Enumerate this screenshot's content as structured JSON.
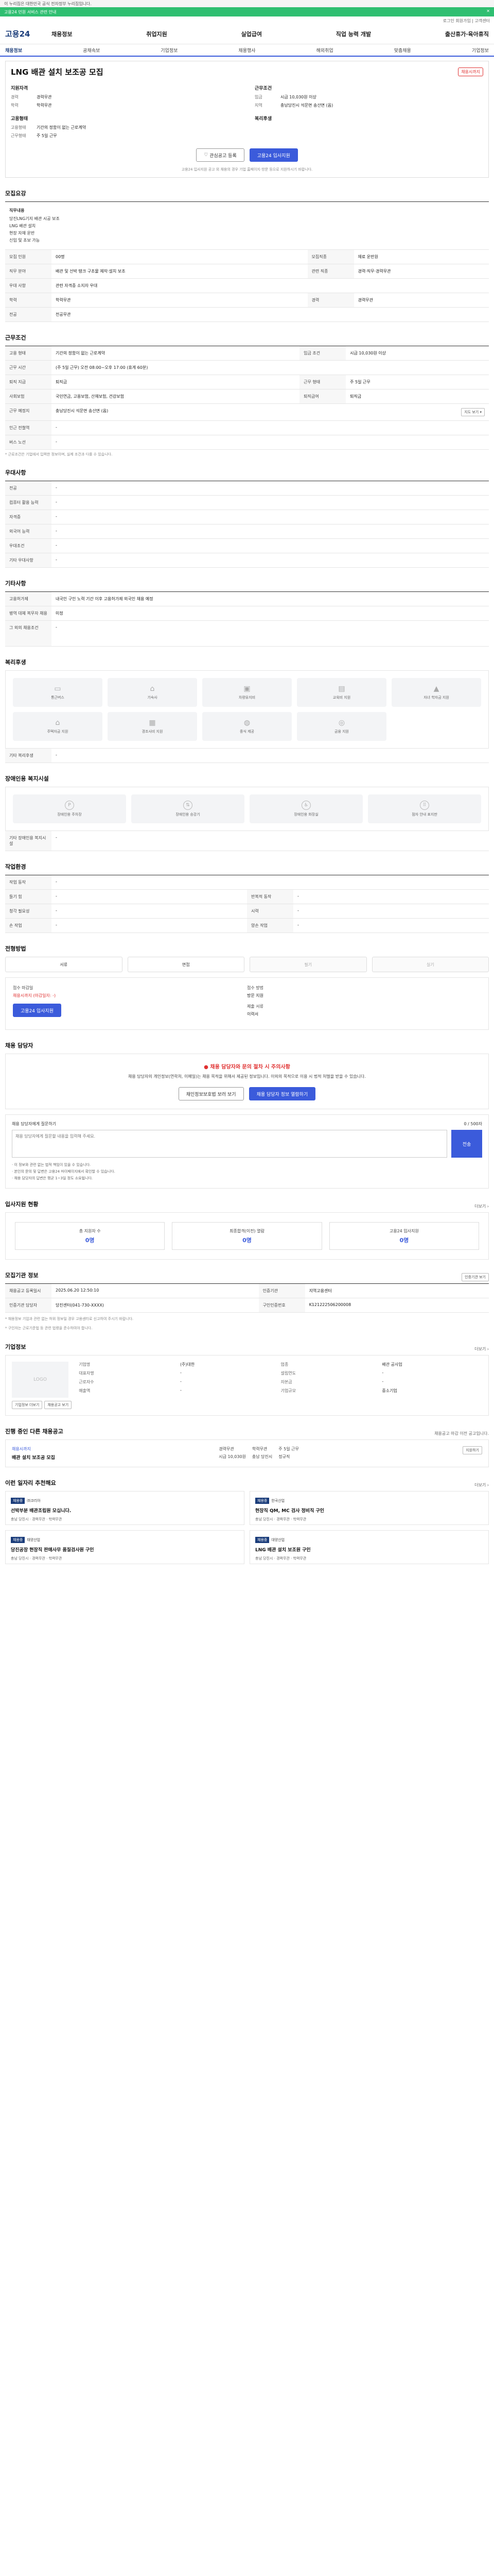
{
  "gov_bar": "이 누리집은 대한민국 공식 전자정부 누리집입니다.",
  "banner": {
    "text": "고용24 민원 서비스 관련 안내",
    "close": "✕"
  },
  "util": "로그인 회원가입 | 고객센터",
  "brand": "고용24",
  "gnb": [
    "채용정보",
    "취업지원",
    "실업급여",
    "직업 능력 개발",
    "출산휴가·육아휴직"
  ],
  "tabs": [
    "채용정보",
    "공채속보",
    "기업정보",
    "채용행사",
    "해외취업",
    "맞춤채용",
    "기업정보"
  ],
  "job": {
    "title": "LNG 배관 설치 보조공 모집",
    "badge": "채용시까지",
    "left_head": "지원자격",
    "left": [
      [
        "경력",
        "경력무관"
      ],
      [
        "학력",
        "학력무관"
      ]
    ],
    "right_head": "근무조건",
    "right": [
      [
        "임금",
        "시급 10,030원 이상"
      ],
      [
        "지역",
        "충남당진시 석문면 송산면 (옵)"
      ]
    ],
    "left2_head": "고용형태",
    "left2": [
      [
        "고용형태",
        "기간의 정함이 없는 근로계약"
      ],
      [
        "근무형태",
        "주 5일 근무"
      ]
    ],
    "right2_head": "복리후생",
    "right2": [],
    "scrap": "관심공고 등록",
    "apply": "고용24 입사지원",
    "note": "고용24 입사지원 공고 외 채용의 경우 기업 홈페이지·방문 등으로 지원하시기 바랍니다."
  },
  "recruit": {
    "heading": "모집요강",
    "duty_head": "직무내용",
    "duty_lines": [
      "당진LNG기지 배관 시공 보조",
      "LNG 배관 설치",
      "현장 자재 운반",
      "신입 및 초보 가능"
    ],
    "rows": [
      [
        "모집 인원",
        "00명",
        "모집직종",
        "재료 운반원"
      ],
      [
        "직무 분야",
        "배관 및 선박 탱크 구조물 제작·설치 보조",
        "관련 직종",
        "경력·직무·경력무관"
      ],
      [
        "우대 사항",
        "관련 자격증 소지자 우대",
        "",
        ""
      ],
      [
        "학력",
        "학력무관",
        "경력",
        "경력무관"
      ],
      [
        "전공",
        "전공무관",
        "",
        ""
      ]
    ]
  },
  "cond": {
    "heading": "근무조건",
    "rows": [
      [
        "고용 형태",
        "기간의 정함이 없는 근로계약",
        "임금 조건",
        "시급 10,030원 이상"
      ],
      [
        "근무 시간",
        "(주 5일 근무) 오전 08:00~오후 17:00 (휴게 60분)",
        "",
        ""
      ],
      [
        "퇴직 지급",
        "퇴직금",
        "근무 형태",
        "주 5일 근무"
      ],
      [
        "사회보험",
        "국민연금, 고용보험, 산재보험, 건강보험",
        "퇴직급여",
        "퇴직금"
      ],
      [
        "근무 예정지",
        "충남당진시 석문면 송산면 (옵)",
        "",
        ""
      ],
      [
        "인근 전철역",
        "-",
        "",
        ""
      ],
      [
        "버스 노선",
        "-",
        "",
        ""
      ]
    ],
    "map_btn": "지도 보기 ▾",
    "footnote": "* 근로조건은 기업에서 입력한 정보이며, 실제 조건과 다를 수 있습니다."
  },
  "pref": {
    "heading": "우대사항",
    "rows": [
      [
        "전공",
        "-"
      ],
      [
        "컴퓨터 활용 능력",
        "-"
      ],
      [
        "자격증",
        "-"
      ],
      [
        "외국어 능력",
        "-"
      ],
      [
        "우대조건",
        "-"
      ],
      [
        "기타 우대사항",
        "-"
      ]
    ]
  },
  "etc": {
    "heading": "기타사항",
    "rows": [
      [
        "고용허가제",
        "내국인 구인 노력 기간 이후 고용허가제 외국인 채용 예정"
      ],
      [
        "병역 대체 복무자 채용",
        "미정"
      ],
      [
        "그 외의 채용조건",
        "-"
      ]
    ]
  },
  "welfare": {
    "heading": "복리후생",
    "items": [
      "통근버스",
      "기숙사",
      "차량유지비",
      "교육비 지원",
      "자녀 학자금 지원",
      "주택자금 지원",
      "경조사비 지원",
      "중식 제공",
      "금융 지원"
    ],
    "other_label": "기타 복리후생",
    "other_value": "-"
  },
  "disab": {
    "heading": "장애인용 복지시설",
    "items": [
      "장애인용 주차장",
      "장애인용 승강기",
      "장애인용 화장실",
      "점자 안내 표지판"
    ],
    "other_label": "기타 장애인용 복지시설",
    "other_value": "-"
  },
  "envir": {
    "heading": "작업환경",
    "rows": [
      [
        "작업 동작",
        "-",
        "",
        ""
      ],
      [
        "들기 힘",
        "-",
        "반복적 동작",
        "-"
      ],
      [
        "청각 필요성",
        "-",
        "시력",
        "-"
      ],
      [
        "손 작업",
        "-",
        "양손 작업",
        "-"
      ]
    ]
  },
  "process": {
    "heading": "전형방법",
    "steps": [
      "서류",
      "면접",
      "필기",
      "실기"
    ],
    "deadline_label": "접수 마감일",
    "deadline": "채용시까지 (마감일자: -)",
    "method_label": "접수 방법",
    "method": "방문 지원",
    "docs_label": "제출 서류",
    "docs": "이력서",
    "apply": "고용24 입사지원"
  },
  "contact": {
    "heading": "채용 담당자",
    "alert_title": "채용 담당자와 문의 절차 시 주의사항",
    "alert_text": "채용 담당자의 개인정보(연락처, 이메일)는 채용 목적을 위해서 제공된 정보입니다. 이외의 목적으로 이용 시 법적 처벌을 받을 수 있습니다.",
    "btn1": "채인정보보호법 보러 보기",
    "btn2": "채용 담당자 정보 열람하기",
    "q_title": "채용 담당자에게 질문하기",
    "q_count": "0 / 500자",
    "q_placeholder": "채용 담당자에게 질문할 내용을 입력해 주세요.",
    "q_send": "전송",
    "q_notes": [
      "· 이 정보와 관련 없는 법적 책임이 있을 수 있습니다.",
      "· 본인의 문의 및 답변은 고용24 마이페이지에서 확인할 수 있습니다.",
      "· 채용 담당자의 답변은 평균 1~3일 정도 소요됩니다."
    ]
  },
  "stats": {
    "heading": "입사지원 현황",
    "more": "더보기 ›",
    "items": [
      [
        "총 지원자 수",
        "0명"
      ],
      [
        "최종합격(이전) 열람",
        "0명"
      ],
      [
        "고용24 입사지원",
        "0명"
      ]
    ]
  },
  "org": {
    "heading": "모집기관 정보",
    "btn": "인증기관 보기",
    "rows": [
      [
        "채용공고 등록일시",
        "2025.06.20 12:50:10",
        "인증기관",
        "지역고용센터"
      ],
      [
        "인증기관 담당자",
        "당진센터(041-730-XXXX)",
        "구인인증번호",
        "K121222506200008"
      ]
    ],
    "notes": [
      "* 채용정보 기업과 관련 없는 허위 정보일 경우 고용센터로 신고하여 주시기 바랍니다.",
      "* 구인자는 근로기준법 등 관련 법령을 준수하여야 합니다."
    ]
  },
  "company": {
    "heading": "기업정보",
    "more": "더보기 ›",
    "logo": "LOGO",
    "info": [
      [
        "기업명",
        "(주)대한"
      ],
      [
        "업종",
        "배관 공사업"
      ],
      [
        "대표자명",
        "-"
      ],
      [
        "설립연도",
        "-"
      ],
      [
        "근로자수",
        "-"
      ],
      [
        "자본금",
        "-"
      ],
      [
        "매출액",
        "-"
      ],
      [
        "기업규모",
        "중소기업"
      ]
    ],
    "btn1": "기업정보 더보기",
    "btn2": "채용공고 보기"
  },
  "similar": {
    "heading": "진행 중인 다른 채용공고",
    "note": "채용공고 마감 이전 공고입니다.",
    "company": "채용시까지",
    "name": "배관 설치 보조공 모집",
    "tags": [
      "경력무관",
      "학력무관",
      "주 5일 근무",
      "시급 10,030원",
      "충남 당진시",
      "정규직"
    ],
    "btn": "지원하기"
  },
  "reco": {
    "heading": "이런 일자리 추천해요",
    "more": "더보기 ›",
    "cards": [
      {
        "badge": "채용중",
        "company": "㈜코리아",
        "title": "선박부분 배관조립원 모십니다.",
        "meta": "충남 당진시 · 경력무관 · 학력무관"
      },
      {
        "badge": "채용중",
        "company": "한국산업",
        "title": "현장직 QM, MC 검사 정비직 구인",
        "meta": "충남 당진시 · 경력무관 · 학력무관"
      },
      {
        "badge": "채용중",
        "company": "태양산업",
        "title": "당진공장 현장직 판매사무 품질검사원 구인",
        "meta": "충남 당진시 · 경력무관 · 학력무관"
      },
      {
        "badge": "채용중",
        "company": "대양산업",
        "title": "LNG 배관 설치 보조원 구인",
        "meta": "충남 당진시 · 경력무관 · 학력무관"
      }
    ]
  }
}
